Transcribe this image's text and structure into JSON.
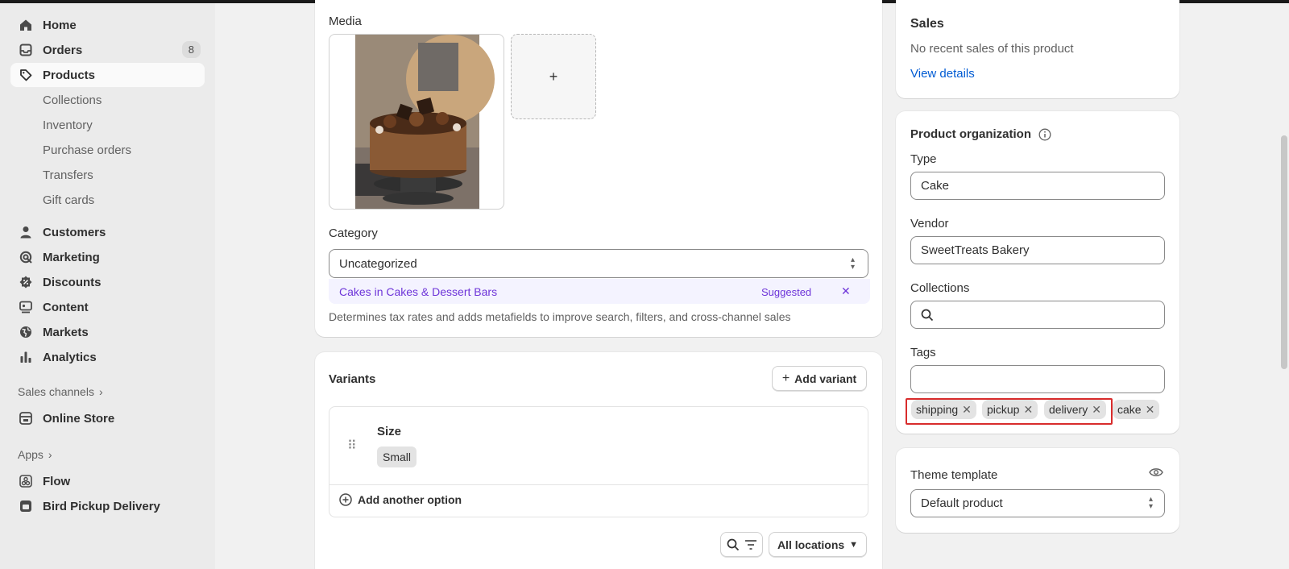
{
  "sidebar": {
    "main": [
      {
        "label": "Home",
        "icon": "home-icon"
      },
      {
        "label": "Orders",
        "icon": "inbox-icon",
        "badge": "8"
      },
      {
        "label": "Products",
        "icon": "tag-icon"
      }
    ],
    "products_sub": [
      "Collections",
      "Inventory",
      "Purchase orders",
      "Transfers",
      "Gift cards"
    ],
    "more": [
      {
        "label": "Customers",
        "icon": "person-icon"
      },
      {
        "label": "Marketing",
        "icon": "target-icon"
      },
      {
        "label": "Discounts",
        "icon": "discount-icon"
      },
      {
        "label": "Content",
        "icon": "content-icon"
      },
      {
        "label": "Markets",
        "icon": "globe-icon"
      },
      {
        "label": "Analytics",
        "icon": "bar-chart-icon"
      }
    ],
    "sales_channels_title": "Sales channels",
    "online_store": "Online Store",
    "apps_title": "Apps",
    "apps": [
      "Flow",
      "Bird Pickup Delivery"
    ]
  },
  "media": {
    "title": "Media",
    "add_symbol": "+"
  },
  "category": {
    "label": "Category",
    "value": "Uncategorized",
    "suggestion_bold": "Cakes",
    "suggestion_rest": " in Cakes & Dessert Bars",
    "suggested_label": "Suggested",
    "dismiss": "✕",
    "help": "Determines tax rates and adds metafields to improve search, filters, and cross-channel sales"
  },
  "variants": {
    "title": "Variants",
    "add_variant": "Add variant",
    "option_name": "Size",
    "option_value": "Small",
    "add_option": "Add another option",
    "locations": "All locations"
  },
  "sales": {
    "title": "Sales",
    "text": "No recent sales of this product",
    "link": "View details"
  },
  "organization": {
    "title": "Product organization",
    "type_label": "Type",
    "type_value": "Cake",
    "vendor_label": "Vendor",
    "vendor_value": "SweetTreats Bakery",
    "collections_label": "Collections",
    "tags_label": "Tags",
    "tags": [
      "shipping",
      "pickup",
      "delivery",
      "cake"
    ],
    "highlight_color": "#d82c2c"
  },
  "theme": {
    "title": "Theme template",
    "value": "Default product"
  }
}
